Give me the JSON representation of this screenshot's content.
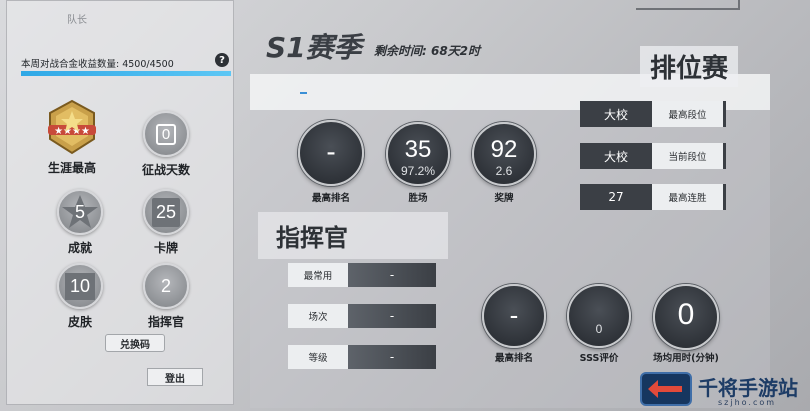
{
  "left_panel": {
    "header": "队长",
    "income_label": "本周对战合金收益数量: 4500/4500",
    "income_progress": 1.0,
    "help_icon": "?",
    "stats": [
      {
        "value": "",
        "label": "生涯最高",
        "icon": "rank-star-badge"
      },
      {
        "value": "0",
        "label": "征战天数",
        "icon": "calendar-icon"
      },
      {
        "value": "5",
        "label": "成就",
        "icon": "star-icon"
      },
      {
        "value": "25",
        "label": "卡牌",
        "icon": "card-icon"
      },
      {
        "value": "10",
        "label": "皮肤",
        "icon": "shirt-icon"
      },
      {
        "value": "2",
        "label": "指挥官",
        "icon": "commander-icon"
      }
    ],
    "redeem_label": "兑换码",
    "logout_label": "登出"
  },
  "season": {
    "title": "S1赛季",
    "remaining": "剩余时间: 68天2时",
    "ranked_title": "排位赛",
    "circles": [
      {
        "main": "-",
        "sub": "",
        "caption": "最高排名"
      },
      {
        "main": "35",
        "sub": "97.2%",
        "caption": "胜场"
      },
      {
        "main": "92",
        "sub": "2.6",
        "caption": "奖牌"
      }
    ],
    "rank_rows": [
      {
        "value": "大校",
        "label": "最高段位"
      },
      {
        "value": "大校",
        "label": "当前段位"
      },
      {
        "value": "27",
        "label": "最高连胜"
      }
    ]
  },
  "commander": {
    "title": "指挥官",
    "rows": [
      {
        "label": "最常用",
        "value": "-"
      },
      {
        "label": "场次",
        "value": "-"
      },
      {
        "label": "等级",
        "value": "-"
      }
    ],
    "circles": [
      {
        "main": "-",
        "sub": "",
        "caption": "最高排名"
      },
      {
        "main": "",
        "sub": "0",
        "caption": "SSS评价"
      },
      {
        "main": "0",
        "sub": "",
        "caption": "场均用时(分钟)"
      }
    ]
  },
  "watermark": {
    "text": "千将手游站",
    "url": "szjho.com"
  }
}
